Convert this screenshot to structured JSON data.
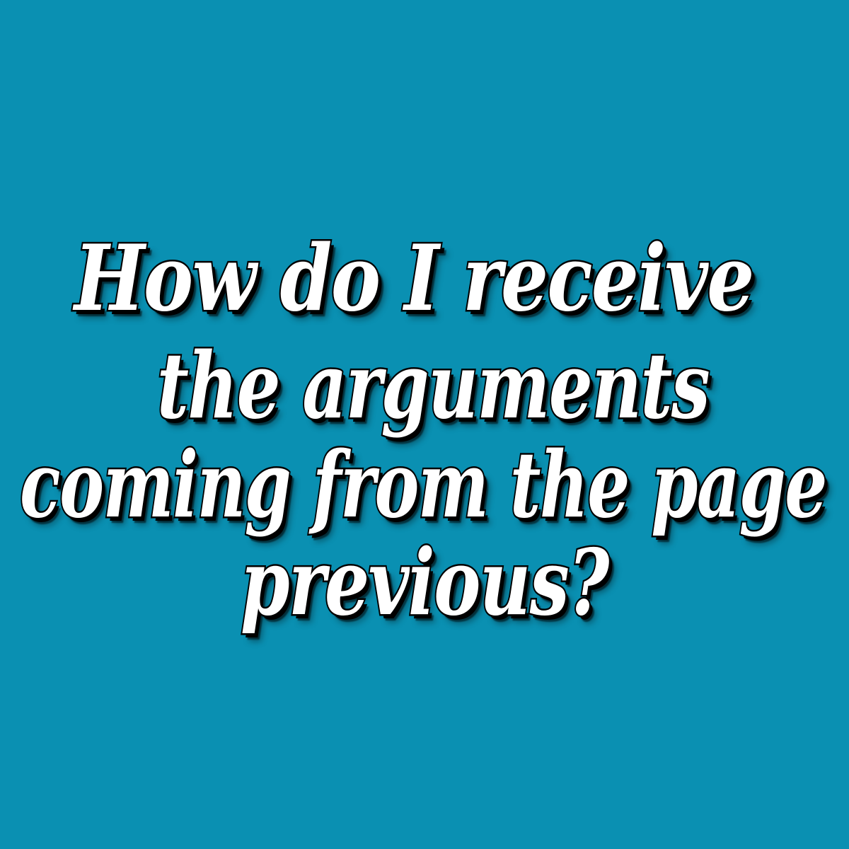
{
  "background_color": "#0a90b2",
  "text_color": "#ffffff",
  "outline_color": "#000000",
  "lines": [
    "How do I receive",
    "the arguments",
    "coming from the page",
    "previous?"
  ]
}
